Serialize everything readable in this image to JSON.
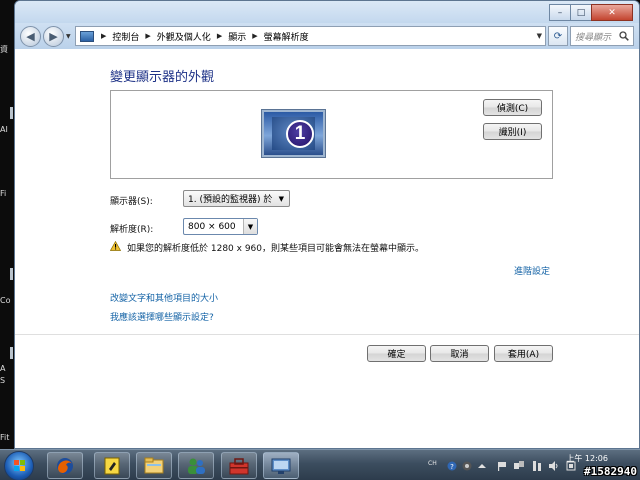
{
  "desktop": {
    "icon_labels": [
      "資",
      "AI",
      "Fi",
      "Co",
      "A",
      "S",
      "Fit"
    ]
  },
  "window": {
    "caption_buttons": {
      "minimize": "–",
      "maximize": "□",
      "close": "✕"
    }
  },
  "nav": {
    "back_icon": "back-arrow-icon",
    "forward_icon": "forward-arrow-icon",
    "breadcrumbs": [
      "控制台",
      "外觀及個人化",
      "顯示",
      "螢幕解析度"
    ],
    "search_placeholder": "搜尋顯示"
  },
  "page": {
    "title": "變更顯示器的外觀",
    "monitor_number": "1",
    "detect_button": "偵測(C)",
    "identify_button": "識別(I)",
    "display_label": "顯示器(S):",
    "display_value": "1. (預設的監視器) 於",
    "resolution_label": "解析度(R):",
    "resolution_value": "800 × 600",
    "warning_text": "如果您的解析度低於 1280 x 960，則某些項目可能會無法在螢幕中顯示。",
    "advanced_link": "進階設定",
    "link_text_size": "改變文字和其他項目的大小",
    "link_which_settings": "我應該選擇哪些顯示設定?",
    "ok_button": "確定",
    "cancel_button": "取消",
    "apply_button": "套用(A)"
  },
  "taskbar": {
    "pinned": [
      "firefox-icon",
      "notes-icon",
      "folder-icon",
      "users-icon",
      "toolbox-icon",
      "display-settings-icon"
    ],
    "tray_lang": "CH",
    "clock_time": "上午 12:06",
    "watermark": "#1582940"
  },
  "colors": {
    "title_blue": "#1e3287",
    "link_blue": "#1463a6",
    "window_frame": "#c7dcef",
    "taskbar": "#3c4d5f"
  }
}
